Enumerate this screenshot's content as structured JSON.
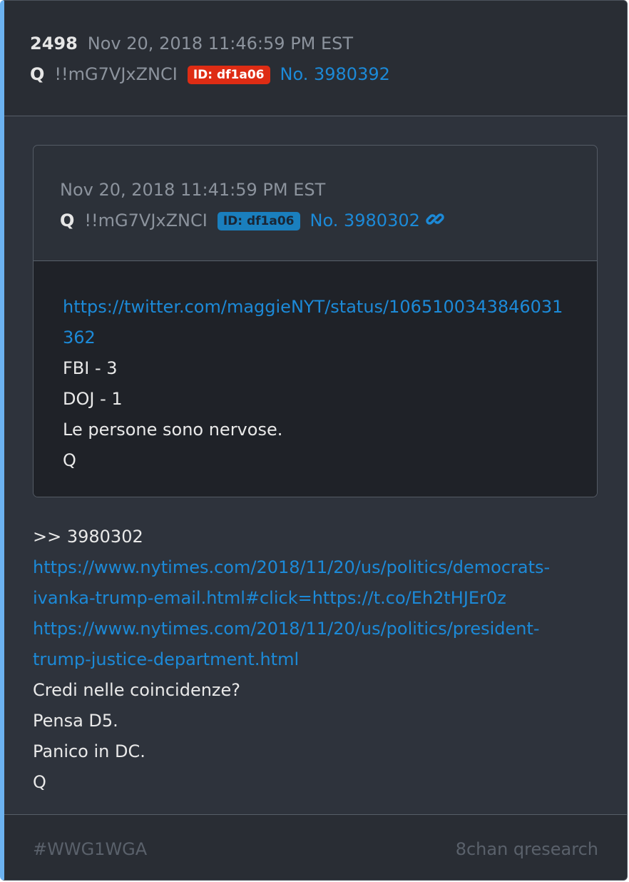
{
  "post": {
    "number": "2498",
    "timestamp": "Nov 20, 2018 11:46:59 PM EST",
    "author": "Q",
    "tripcode": "!!mG7VJxZNCI",
    "id_badge": "ID: df1a06",
    "post_no": "No. 3980392",
    "colors": {
      "id_badge": "#de2c14",
      "link": "#1c8ad8",
      "accent_border": "#6cb2f0"
    }
  },
  "quoted_post": {
    "timestamp": "Nov 20, 2018 11:41:59 PM EST",
    "author": "Q",
    "tripcode": "!!mG7VJxZNCI",
    "id_badge": "ID: df1a06",
    "post_no": "No. 3980302",
    "link_icon": "chain-link-icon",
    "body": {
      "url": "https://twitter.com/maggieNYT/status/1065100343846031362",
      "lines": [
        "FBI - 3",
        "DOJ - 1",
        "Le persone sono nervose.",
        "Q"
      ]
    },
    "colors": {
      "id_badge": "#1a7fbe"
    }
  },
  "main_body": {
    "reply_ref": ">> 3980302",
    "link1_line1": "https://www.nytimes.com/2018/11/20/us/politics/democrats-",
    "link1_line2": "ivanka-trump-email.html#click=https://t.co/Eh2tHJEr0z",
    "link2_line1": "https://www.nytimes.com/2018/11/20/us/politics/president-",
    "link2_line2": "trump-justice-department.html",
    "lines": [
      "Credi nelle coincidenze?",
      "Pensa D5.",
      "Panico in DC.",
      "Q"
    ]
  },
  "footer": {
    "tag": "#WWG1WGA",
    "source": "8chan qresearch"
  }
}
